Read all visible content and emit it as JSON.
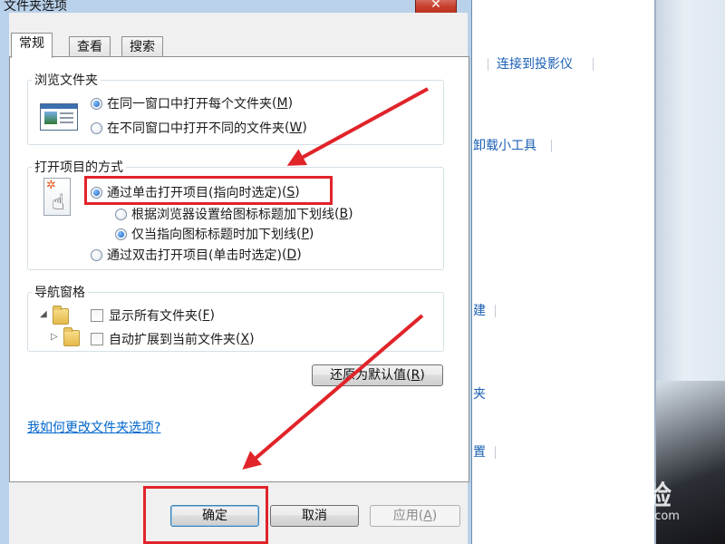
{
  "dialog": {
    "title": "文件夹选项",
    "close_glyph": "✕",
    "tabs": [
      {
        "label": "常规",
        "active": true
      },
      {
        "label": "查看",
        "active": false
      },
      {
        "label": "搜索",
        "active": false
      }
    ],
    "browse_group": {
      "title": "浏览文件夹",
      "options": [
        {
          "text": "在同一窗口中打开每个文件夹",
          "key": "M",
          "checked": true
        },
        {
          "text": "在不同窗口中打开不同的文件夹",
          "key": "W",
          "checked": false
        }
      ]
    },
    "click_group": {
      "title": "打开项目的方式",
      "single_click": {
        "text": "通过单击打开项目(指向时选定)",
        "key": "S",
        "checked": true
      },
      "underline_browser": {
        "text": "根据浏览器设置给图标标题加下划线",
        "key": "B",
        "checked": false
      },
      "underline_point": {
        "text": "仅当指向图标标题时加下划线",
        "key": "P",
        "checked": true
      },
      "double_click": {
        "text": "通过双击打开项目(单击时选定)",
        "key": "D",
        "checked": false
      }
    },
    "nav_group": {
      "title": "导航窗格",
      "show_all": {
        "text": "显示所有文件夹",
        "key": "F",
        "checked": false
      },
      "auto_expand": {
        "text": "自动扩展到当前文件夹",
        "key": "X",
        "checked": false
      }
    },
    "restore_button": {
      "text": "还原为默认值",
      "key": "R"
    },
    "help_link": "我如何更改文件夹选项?",
    "ok_button": "确定",
    "cancel_button": "取消",
    "apply_button": {
      "text": "应用",
      "key": "A"
    }
  },
  "background": {
    "links": [
      "连接到投影仪",
      "卸载小工具",
      "建",
      "夹",
      "置"
    ]
  },
  "watermark": {
    "brand": "Bai 经验",
    "url": "jingyan.baidu.com"
  },
  "icons": {
    "close": "close-icon",
    "folder": "folder-icon",
    "hand": "hand-pointer-icon",
    "window": "window-preview-icon"
  },
  "colors": {
    "annotation": "#e0242a",
    "dialog_frame": "#b9d1ea",
    "link": "#0066cc"
  }
}
